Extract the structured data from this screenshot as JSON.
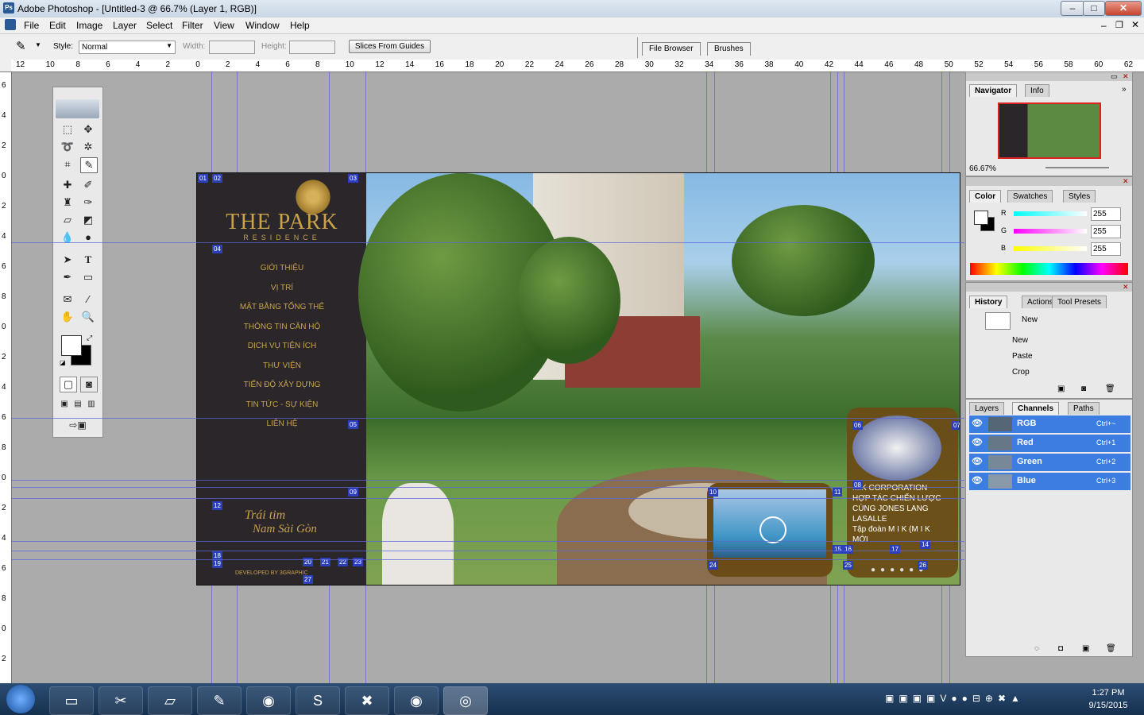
{
  "window": {
    "title": "Adobe Photoshop - [Untitled-3 @ 66.7% (Layer 1, RGB)]",
    "app_icon": "Ps",
    "controls": {
      "minimize": "–",
      "maximize": "□",
      "close": "✕"
    }
  },
  "menu": [
    "File",
    "Edit",
    "Image",
    "Layer",
    "Select",
    "Filter",
    "View",
    "Window",
    "Help"
  ],
  "options": {
    "style_label": "Style:",
    "style_value": "Normal",
    "width_label": "Width:",
    "height_label": "Height:",
    "slices_button": "Slices From Guides",
    "tabs": [
      "File Browser",
      "Brushes"
    ]
  },
  "ruler": {
    "h_labels": [
      "12",
      "10",
      "8",
      "6",
      "4",
      "2",
      "0",
      "2",
      "4",
      "6",
      "8",
      "10",
      "12",
      "14",
      "16",
      "18",
      "20",
      "22",
      "24",
      "26",
      "28",
      "30",
      "32",
      "34",
      "36",
      "38",
      "40",
      "42",
      "44",
      "46",
      "48",
      "50",
      "52",
      "54",
      "56",
      "58",
      "60",
      "62"
    ],
    "v_labels": [
      "6",
      "4",
      "2",
      "0",
      "2",
      "4",
      "6",
      "8",
      "0",
      "2",
      "4",
      "6",
      "8",
      "0",
      "2",
      "4",
      "6",
      "8",
      "0",
      "2"
    ]
  },
  "document": {
    "brand": "THE PARK",
    "brand_sub": "RESIDENCE",
    "nav": [
      "GIỚI THIỆU",
      "VỊ TRÍ",
      "MẶT BẰNG TỔNG THỂ",
      "THÔNG TIN CĂN HỘ",
      "DỊCH VỤ TIỆN ÍCH",
      "THƯ VIỆN",
      "TIẾN ĐỘ XÂY DỰNG",
      "TIN TỨC - SỰ KIỆN",
      "LIÊN HỆ"
    ],
    "signature_1": "Trái tim",
    "signature_2": "Nam Sài Gòn",
    "developer": "DEVELOPED BY 3GRAPHIC",
    "news": {
      "line1": "MIK CORPORATION",
      "line2": "HỢP TÁC CHIẾN LƯỢC",
      "line3": "CÙNG JONES LANG",
      "line4": "LASALLE",
      "line5": "Tập đoàn M I K (M I K",
      "line6": "MỚI"
    },
    "slice_labels": [
      "01",
      "02",
      "03",
      "04",
      "05",
      "06",
      "07",
      "08",
      "09",
      "10",
      "11",
      "12",
      "14",
      "15",
      "16",
      "17",
      "18",
      "19",
      "20",
      "21",
      "22",
      "23",
      "24",
      "25",
      "26",
      "27"
    ]
  },
  "navigator": {
    "tabs": [
      "Navigator",
      "Info"
    ],
    "zoom": "66.67%"
  },
  "color": {
    "tabs": [
      "Color",
      "Swatches",
      "Styles"
    ],
    "r_label": "R",
    "g_label": "G",
    "b_label": "B",
    "r": "255",
    "g": "255",
    "b": "255"
  },
  "history": {
    "tabs": [
      "History",
      "Actions",
      "Tool Presets"
    ],
    "snapshot": "New",
    "items": [
      "New",
      "Paste",
      "Crop"
    ]
  },
  "channels": {
    "tabs": [
      "Layers",
      "Channels",
      "Paths"
    ],
    "rows": [
      {
        "name": "RGB",
        "shortcut": "Ctrl+~"
      },
      {
        "name": "Red",
        "shortcut": "Ctrl+1"
      },
      {
        "name": "Green",
        "shortcut": "Ctrl+2"
      },
      {
        "name": "Blue",
        "shortcut": "Ctrl+3"
      }
    ]
  },
  "taskbar": {
    "time": "1:27 PM",
    "date": "9/15/2015"
  },
  "colors": {
    "accent_gold": "#c8a34c",
    "channel_highlight": "#3b7de0",
    "guide": "#5a67d8",
    "slice_tag": "#2b3fbd"
  }
}
